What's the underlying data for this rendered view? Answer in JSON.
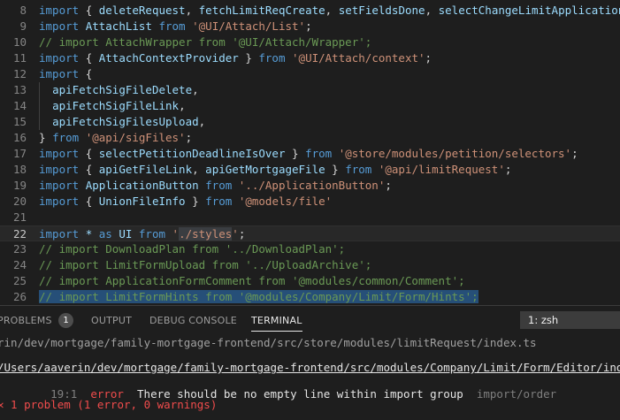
{
  "editor": {
    "lines": [
      {
        "n": "8",
        "segs": [
          [
            "kw",
            "import "
          ],
          [
            "pn",
            "{ "
          ],
          [
            "id",
            "deleteRequest"
          ],
          [
            "pn",
            ", "
          ],
          [
            "id",
            "fetchLimitReqCreate"
          ],
          [
            "pn",
            ", "
          ],
          [
            "id",
            "setFieldsDone"
          ],
          [
            "pn",
            ", "
          ],
          [
            "id",
            "selectChangeLimitApplication"
          ],
          [
            "pn",
            ", s"
          ]
        ]
      },
      {
        "n": "9",
        "segs": [
          [
            "kw",
            "import "
          ],
          [
            "id",
            "AttachList "
          ],
          [
            "kw",
            "from "
          ],
          [
            "str",
            "'@UI/Attach/List'"
          ],
          [
            "pn",
            ";"
          ]
        ]
      },
      {
        "n": "10",
        "segs": [
          [
            "cm",
            "// import AttachWrapper from '@UI/Attach/Wrapper';"
          ]
        ]
      },
      {
        "n": "11",
        "segs": [
          [
            "kw",
            "import "
          ],
          [
            "pn",
            "{ "
          ],
          [
            "id",
            "AttachContextProvider"
          ],
          [
            "pn",
            " } "
          ],
          [
            "kw",
            "from "
          ],
          [
            "str",
            "'@UI/Attach/context'"
          ],
          [
            "pn",
            ";"
          ]
        ]
      },
      {
        "n": "12",
        "segs": [
          [
            "kw",
            "import "
          ],
          [
            "pn",
            "{"
          ]
        ]
      },
      {
        "n": "13",
        "segs": [
          [
            "pn",
            "  "
          ],
          [
            "id",
            "apiFetchSigFileDelete"
          ],
          [
            "pn",
            ","
          ]
        ]
      },
      {
        "n": "14",
        "segs": [
          [
            "pn",
            "  "
          ],
          [
            "id",
            "apiFetchSigFileLink"
          ],
          [
            "pn",
            ","
          ]
        ]
      },
      {
        "n": "15",
        "segs": [
          [
            "pn",
            "  "
          ],
          [
            "id",
            "apiFetchSigFilesUpload"
          ],
          [
            "pn",
            ","
          ]
        ]
      },
      {
        "n": "16",
        "segs": [
          [
            "pn",
            "} "
          ],
          [
            "kw",
            "from "
          ],
          [
            "str",
            "'@api/sigFiles'"
          ],
          [
            "pn",
            ";"
          ]
        ]
      },
      {
        "n": "17",
        "segs": [
          [
            "kw",
            "import "
          ],
          [
            "pn",
            "{ "
          ],
          [
            "id",
            "selectPetitionDeadlineIsOver"
          ],
          [
            "pn",
            " } "
          ],
          [
            "kw",
            "from "
          ],
          [
            "str",
            "'@store/modules/petition/selectors'"
          ],
          [
            "pn",
            ";"
          ]
        ]
      },
      {
        "n": "18",
        "segs": [
          [
            "kw",
            "import "
          ],
          [
            "pn",
            "{ "
          ],
          [
            "id",
            "apiGetFileLink"
          ],
          [
            "pn",
            ", "
          ],
          [
            "id",
            "apiGetMortgageFile"
          ],
          [
            "pn",
            " } "
          ],
          [
            "kw",
            "from "
          ],
          [
            "str",
            "'@api/limitRequest'"
          ],
          [
            "pn",
            ";"
          ]
        ]
      },
      {
        "n": "19",
        "segs": [
          [
            "kw",
            "import "
          ],
          [
            "id",
            "ApplicationButton "
          ],
          [
            "kw",
            "from "
          ],
          [
            "str",
            "'../ApplicationButton'"
          ],
          [
            "pn",
            ";"
          ]
        ]
      },
      {
        "n": "20",
        "segs": [
          [
            "kw",
            "import "
          ],
          [
            "pn",
            "{ "
          ],
          [
            "id",
            "UnionFileInfo"
          ],
          [
            "pn",
            " } "
          ],
          [
            "kw",
            "from "
          ],
          [
            "str",
            "'@models/file'"
          ]
        ]
      },
      {
        "n": "21",
        "segs": []
      },
      {
        "n": "22",
        "current": true,
        "segs": [
          [
            "kw",
            "import "
          ],
          [
            "id",
            "* "
          ],
          [
            "kw",
            "as "
          ],
          [
            "id",
            "UI "
          ],
          [
            "kw",
            "from "
          ],
          [
            "str",
            "'"
          ],
          [
            "strhl",
            "./styles"
          ],
          [
            "str",
            "'"
          ],
          [
            "pn",
            ";"
          ]
        ]
      },
      {
        "n": "23",
        "segs": [
          [
            "cm",
            "// import DownloadPlan from '../DownloadPlan';"
          ]
        ]
      },
      {
        "n": "24",
        "segs": [
          [
            "cm",
            "// import LimitFormUpload from '../UploadArchive';"
          ]
        ]
      },
      {
        "n": "25",
        "segs": [
          [
            "cm",
            "// import ApplicationFormComment from '@modules/common/Comment';"
          ]
        ]
      },
      {
        "n": "26",
        "segs": [
          [
            "cmhl",
            "// import LimitFormHints from '@modules/Company/Limit/Form/Hints';"
          ]
        ]
      }
    ]
  },
  "panel": {
    "tabs": [
      {
        "label": "PROBLEMS",
        "name": "tab-problems"
      },
      {
        "label": "OUTPUT",
        "name": "tab-output"
      },
      {
        "label": "DEBUG CONSOLE",
        "name": "tab-debug-console"
      },
      {
        "label": "TERMINAL",
        "name": "tab-terminal"
      }
    ],
    "problems_count": "1",
    "active_tab": "TERMINAL",
    "terminal_select": "1: zsh",
    "terminal": {
      "line1": "rin/dev/mortgage/family-mortgage-frontend/src/store/modules/limitRequest/index.ts",
      "line2": "/Users/aaverin/dev/mortgage/family-mortgage-frontend/src/modules/Company/Limit/Form/Editor/index.tsx",
      "error_pos": "19:1",
      "error_level": "error",
      "error_msg": "There should be no empty line within import group",
      "error_rule": "import/order",
      "summary": "✕ 1 problem (1 error, 0 warnings)"
    }
  }
}
